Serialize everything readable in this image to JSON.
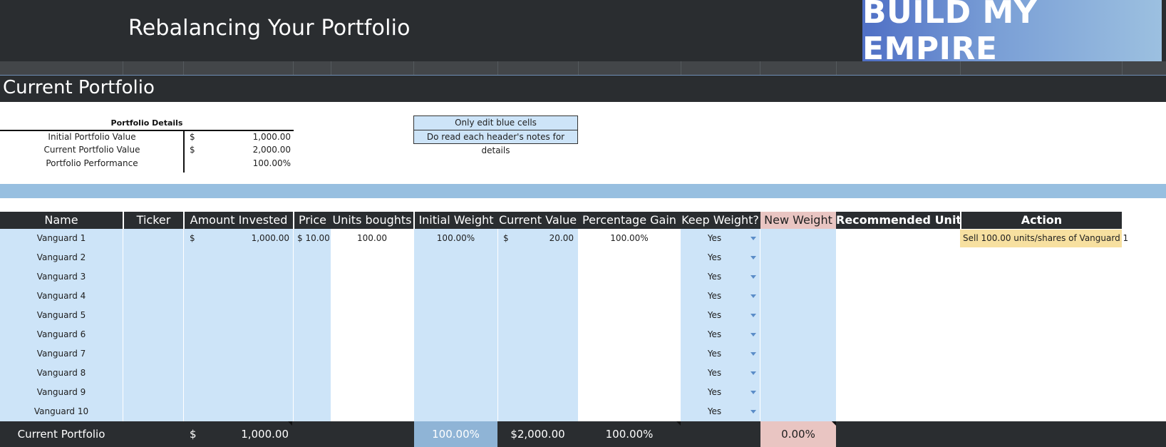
{
  "banner": {
    "title": "Rebalancing Your Portfolio",
    "logo_text": "BUILD MY EMPIRE"
  },
  "section": {
    "title": "Current Portfolio"
  },
  "details": {
    "title": "Portfolio Details",
    "rows": [
      {
        "label": "Initial Portfolio Value",
        "currency": "$",
        "value": "1,000.00"
      },
      {
        "label": "Current Portfolio Value",
        "currency": "$",
        "value": "2,000.00"
      },
      {
        "label": "Portfolio Performance",
        "currency": "",
        "value": "100.00%"
      }
    ]
  },
  "notes": {
    "line1": "Only edit blue cells",
    "line2": "Do read each header's notes for details"
  },
  "table": {
    "headers": {
      "name": "Name",
      "ticker": "Ticker",
      "amount": "Amount Invested",
      "price": "Price",
      "units": "Units boughts",
      "initial_weight": "Initial Weight",
      "current_value": "Current Value",
      "gain": "Percentage Gain",
      "keep": "Keep Weight?",
      "new_weight": "New Weight",
      "recommended": "Recommended Units",
      "action": "Action"
    },
    "rows": [
      {
        "name": "Vanguard 1",
        "amount_cur": "$",
        "amount": "1,000.00",
        "price": "$ 10.00",
        "units": "100.00",
        "initial_weight": "100.00%",
        "current_value_cur": "$",
        "current_value": "20.00",
        "gain": "100.00%",
        "keep": "Yes",
        "action": "Sell 100.00 units/shares of Vanguard 1"
      },
      {
        "name": "Vanguard 2",
        "keep": "Yes"
      },
      {
        "name": "Vanguard 3",
        "keep": "Yes"
      },
      {
        "name": "Vanguard 4",
        "keep": "Yes"
      },
      {
        "name": "Vanguard 5",
        "keep": "Yes"
      },
      {
        "name": "Vanguard 6",
        "keep": "Yes"
      },
      {
        "name": "Vanguard 7",
        "keep": "Yes"
      },
      {
        "name": "Vanguard 8",
        "keep": "Yes"
      },
      {
        "name": "Vanguard 9",
        "keep": "Yes"
      },
      {
        "name": "Vanguard 10",
        "keep": "Yes"
      }
    ]
  },
  "footer": {
    "label": "Current Portfolio",
    "amount_cur": "$",
    "amount": "1,000.00",
    "initial_weight": "100.00%",
    "current_value": "$2,000.00",
    "gain": "100.00%",
    "new_weight": "0.00%"
  },
  "colors": {
    "banner": "#2a2d30",
    "edit_blue": "#cde4f8",
    "strip_blue": "#97bfe0",
    "new_weight_pink": "#e9c5c2",
    "action_yellow": "#f7e0a0"
  }
}
